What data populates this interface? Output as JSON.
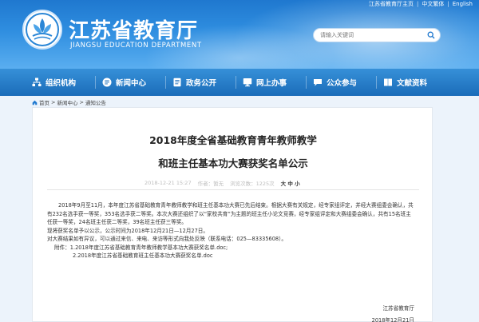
{
  "header": {
    "site_title": "江苏省教育厅",
    "site_subtitle": "JIANGSU EDUCATION DEPARTMENT",
    "top_links": [
      "江苏省教育厅主页",
      "中文繁体",
      "English"
    ],
    "search": {
      "placeholder": "请输入关键词"
    }
  },
  "nav": {
    "items": [
      {
        "label": "组织机构",
        "icon": "org-chart-icon"
      },
      {
        "label": "新闻中心",
        "icon": "news-icon"
      },
      {
        "label": "政务公开",
        "icon": "government-affairs-icon"
      },
      {
        "label": "网上办事",
        "icon": "online-service-icon"
      },
      {
        "label": "公众参与",
        "icon": "public-participation-icon"
      },
      {
        "label": "文献资料",
        "icon": "documents-icon"
      }
    ]
  },
  "breadcrumb": {
    "items": [
      "首页",
      "新闻中心",
      "通知公告"
    ],
    "separator": ">"
  },
  "article": {
    "title_line1": "2018年度全省基础教育青年教师教学",
    "title_line2": "和班主任基本功大赛获奖名单公示",
    "date": "2018-12-21 15:27",
    "author_label": "作者：",
    "author": "暂无",
    "views_label": "浏览次数：",
    "views": "1225次",
    "font_size_label": "大 中 小",
    "paragraph1": "2018年9月至11月，本年度江苏省基础教育青年教师教学和班主任基本功大赛已先后结束。根据大赛有关规定，经专家组评定，并经大赛组委会确认，共有232名选手获一等奖，353名选手获二等奖。本次大赛还组织了以“家校共育”为主题的班主任小论文竞赛，经专家组评定和大赛组委会确认，共有15名班主任获一等奖，24名班主任获二等奖，39名班主任获三等奖。",
    "paragraph2": "现将获奖名单予以公示，公示时间为2018年12月21日—12月27日。",
    "paragraph3": "对大赛结果如有异议，可以通过来信、来电、来访等形式向我处反映（联系电话：025—83335608）。",
    "attachment1": "附件：1.2018年度江苏省基础教育青年教师教学基本功大赛获奖名单.doc;",
    "attachment2": "2.2018年度江苏省基础教育班主任基本功大赛获奖名单.doc",
    "signature_org": "江苏省教育厅",
    "signature_date": "2018年12月21日"
  },
  "colors": {
    "header_blue": "#1f78cf",
    "nav_blue": "#1b6cb9",
    "page_bg": "#ecf3fb"
  }
}
